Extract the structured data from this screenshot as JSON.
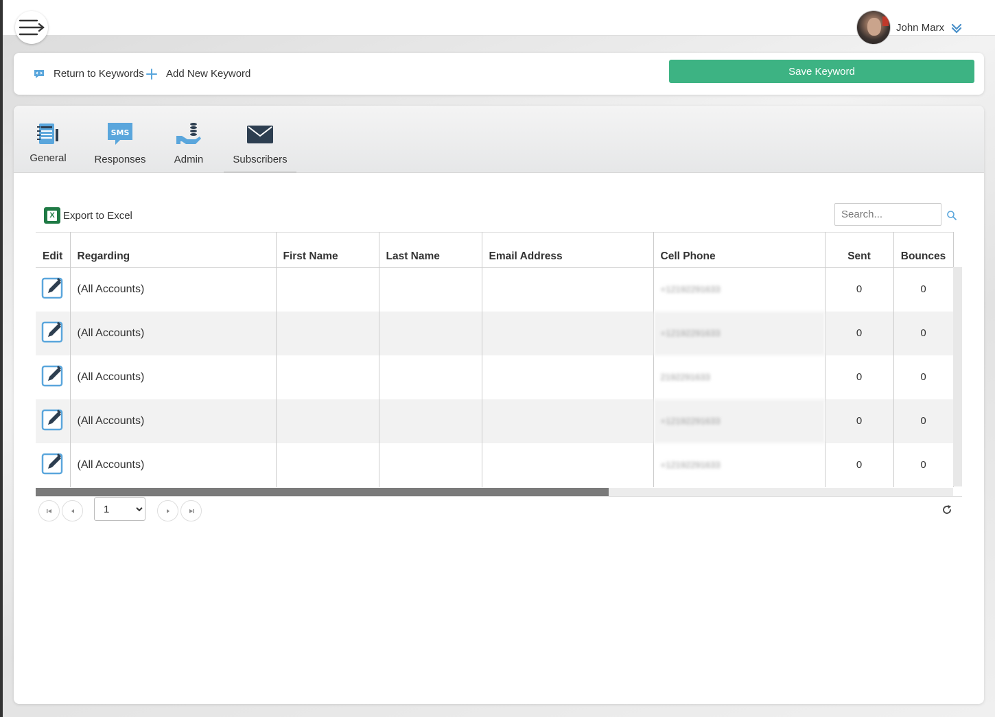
{
  "user": {
    "name": "John Marx"
  },
  "breadcrumb": {
    "return_label": "Return to Keywords",
    "add_label": "Add New Keyword"
  },
  "toolbar": {
    "save_label": "Save Keyword",
    "save_color": "#3db383"
  },
  "tabs": [
    {
      "label": "General",
      "icon": "notebook-icon"
    },
    {
      "label": "Responses",
      "icon": "sms-icon"
    },
    {
      "label": "Admin",
      "icon": "hand-coins-icon"
    },
    {
      "label": "Subscribers",
      "icon": "envelope-icon",
      "active": true
    }
  ],
  "grid": {
    "export_label": "Export to Excel",
    "search_placeholder": "Search...",
    "columns": [
      "Edit",
      "Regarding",
      "First Name",
      "Last Name",
      "Email Address",
      "Cell Phone",
      "Sent",
      "Bounces"
    ],
    "rows": [
      {
        "regarding": "(All Accounts)",
        "first": "",
        "last": "",
        "email": "",
        "phone": "+12192291633",
        "sent": "0",
        "bounces": "0"
      },
      {
        "regarding": "(All Accounts)",
        "first": "",
        "last": "",
        "email": "",
        "phone": "+12192291633",
        "sent": "0",
        "bounces": "0"
      },
      {
        "regarding": "(All Accounts)",
        "first": "",
        "last": "",
        "email": "",
        "phone": "2192291633",
        "sent": "0",
        "bounces": "0"
      },
      {
        "regarding": "(All Accounts)",
        "first": "",
        "last": "",
        "email": "",
        "phone": "+12192291633",
        "sent": "0",
        "bounces": "0"
      },
      {
        "regarding": "(All Accounts)",
        "first": "",
        "last": "",
        "email": "",
        "phone": "+12192291633",
        "sent": "0",
        "bounces": "0"
      }
    ]
  },
  "pager": {
    "page": "1"
  }
}
